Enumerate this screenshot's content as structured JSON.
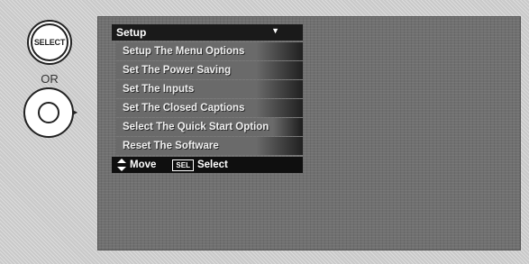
{
  "remote": {
    "select_button_label": "SELECT",
    "or_label": "OR",
    "select_icon": "select-button-icon",
    "right_icon": "right-arrow-button-icon"
  },
  "menu": {
    "title": "Setup",
    "items": [
      {
        "label": "Setup The Menu Options"
      },
      {
        "label": "Set The Power Saving"
      },
      {
        "label": "Set The Inputs"
      },
      {
        "label": "Set The Closed Captions"
      },
      {
        "label": "Select The Quick Start Option"
      },
      {
        "label": "Reset The Software"
      }
    ],
    "footer": {
      "move_label": "Move",
      "sel_key_label": "SEL",
      "select_label": "Select"
    }
  },
  "colors": {
    "screen": "#707070",
    "menu_header": "#1a1a1a",
    "menu_item": "#6a6a6a"
  }
}
